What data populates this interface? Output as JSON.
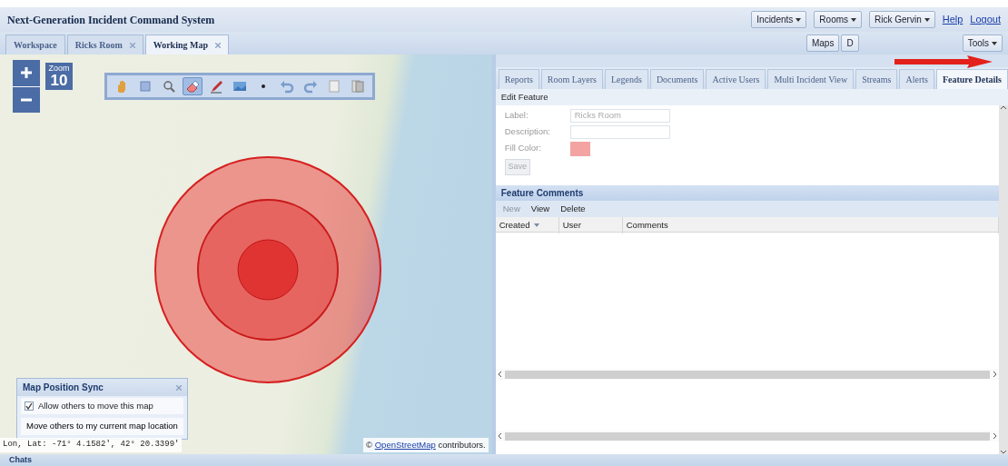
{
  "app": {
    "title": "Next-Generation Incident Command System"
  },
  "header_menus": [
    {
      "label": "Incidents",
      "kind": "dropdown"
    },
    {
      "label": "Rooms",
      "kind": "dropdown"
    },
    {
      "label": "Rick Gervin",
      "kind": "dropdown"
    }
  ],
  "header_links": [
    "Help",
    "Logout"
  ],
  "workspace_tabs": [
    {
      "label": "Workspace",
      "closable": false,
      "selected": false
    },
    {
      "label": "Ricks Room",
      "closable": true,
      "selected": false
    },
    {
      "label": "Working Map",
      "closable": true,
      "selected": true
    }
  ],
  "tab_bar_buttons": [
    {
      "label": "Maps",
      "kind": "button"
    },
    {
      "label": "D",
      "kind": "button"
    },
    {
      "label": "Tools",
      "kind": "dropdown"
    }
  ],
  "map": {
    "zoom_label": "Zoom",
    "zoom_level": "10",
    "tools": [
      {
        "selected": false
      },
      {
        "selected": false
      },
      {
        "selected": false
      },
      {
        "selected": true
      },
      {
        "selected": false
      },
      {
        "selected": false
      },
      {
        "selected": false
      },
      {
        "selected": false
      },
      {
        "selected": false
      },
      {
        "selected": false
      },
      {
        "selected": false
      }
    ],
    "sync_panel": {
      "title": "Map Position Sync",
      "allow_move": {
        "label": "Allow others to move this map",
        "checked": true
      },
      "move_others_button": "Move others to my current map location"
    },
    "coordinates": "Lon, Lat: -71° 4.1582', 42° 20.3399'",
    "attribution": {
      "symbol": "©",
      "link": "OpenStreetMap",
      "text": "contributors."
    }
  },
  "panel": {
    "tabs": [
      {
        "label": "Reports",
        "selected": false
      },
      {
        "label": "Room Layers",
        "selected": false
      },
      {
        "label": "Legends",
        "selected": false
      },
      {
        "label": "Documents",
        "selected": false
      },
      {
        "label": "Active Users",
        "selected": false
      },
      {
        "label": "Multi Incident View",
        "selected": false
      },
      {
        "label": "Streams",
        "selected": false
      },
      {
        "label": "Alerts",
        "selected": false
      },
      {
        "label": "Feature Details",
        "selected": true
      }
    ],
    "edit_feature_label": "Edit Feature",
    "form": {
      "label_caption": "Label:",
      "label_value": "Ricks Room",
      "description_caption": "Description:",
      "fill_color_caption": "Fill Color:",
      "save_button": {
        "label": "Save",
        "disabled": true
      }
    },
    "comments": {
      "title": "Feature Comments",
      "actions": [
        {
          "label": "New",
          "disabled": true
        },
        {
          "label": "View",
          "disabled": false
        },
        {
          "label": "Delete",
          "disabled": false
        }
      ],
      "columns": [
        {
          "label": "Created",
          "sorted": true
        },
        {
          "label": "User",
          "sorted": false
        },
        {
          "label": "Comments",
          "sorted": false
        }
      ]
    }
  },
  "chats": {
    "title": "Chats"
  }
}
